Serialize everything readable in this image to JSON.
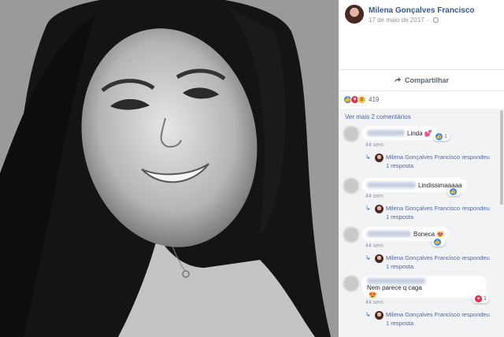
{
  "post": {
    "author": "Milena Gonçalves Francisco",
    "date": "17 de maio de 2017",
    "separator": "·",
    "share_label": "Compartilhar",
    "reaction_count": "419"
  },
  "comments_section": {
    "more_comments": "Ver mais 2 comentários",
    "comments": [
      {
        "text": "Linda",
        "emoji": "💕",
        "reaction_count": "1",
        "reaction": "like-icon",
        "time": "44 sem",
        "reply": {
          "author": "Milena Gonçalves Francisco",
          "action": "respondeu",
          "count": "1 resposta"
        }
      },
      {
        "text": "Lindissimaaaaa",
        "emoji": "",
        "reaction_count": "",
        "reaction": "like-icon",
        "time": "44 sem",
        "reply": {
          "author": "Milena Gonçalves Francisco",
          "action": "respondeu",
          "count": "1 resposta"
        }
      },
      {
        "text": "Boneca",
        "emoji": "😻",
        "reaction_count": "",
        "reaction": "like-icon",
        "time": "44 sem",
        "reply": {
          "author": "Milena Gonçalves Francisco",
          "action": "respondeu",
          "count": "1 resposta"
        }
      },
      {
        "text": "Nem parece q caga",
        "emoji": "😍",
        "reaction_count": "1",
        "reaction": "love-icon",
        "time": "44 sem",
        "reply": {
          "author": "Milena Gonçalves Francisco",
          "action": "respondeu",
          "count": "1 resposta"
        }
      }
    ]
  },
  "colors": {
    "link": "#365899",
    "panel_bg": "#f2f3f5",
    "like": "#2e89ff",
    "love": "#f0284a"
  }
}
